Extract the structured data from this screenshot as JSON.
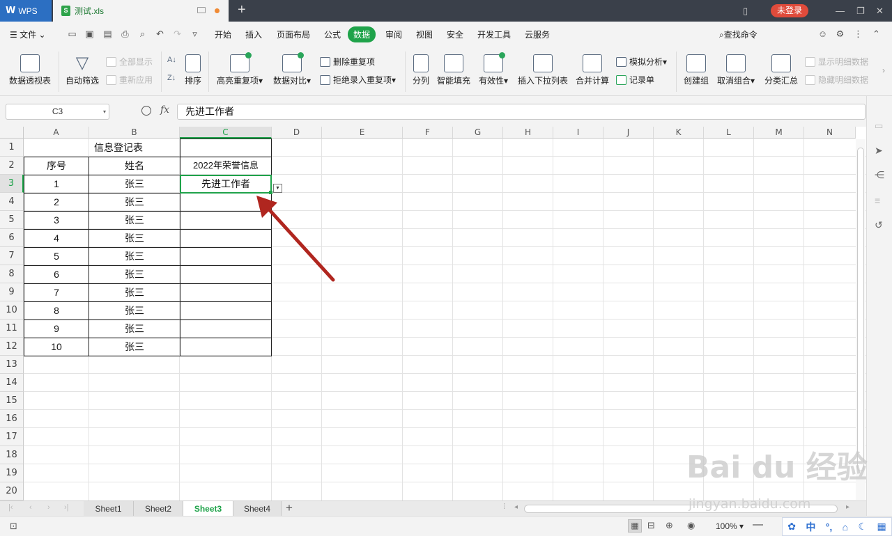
{
  "titlebar": {
    "app_label": "WPS",
    "doc_name": "测试.xls",
    "login_label": "未登录"
  },
  "menu": {
    "file_label": "文件",
    "tabs": [
      "开始",
      "插入",
      "页面布局",
      "公式",
      "数据",
      "审阅",
      "视图",
      "安全",
      "开发工具",
      "云服务"
    ],
    "active_tab": "数据",
    "search_label": "查找命令"
  },
  "ribbon": {
    "pivot": "数据透视表",
    "autofilter": "自动筛选",
    "show_all": "全部显示",
    "reapply": "重新应用",
    "sort": "排序",
    "highlight_dup": "高亮重复项",
    "compare": "数据对比",
    "delete_dup": "删除重复项",
    "reject_dup": "拒绝录入重复项",
    "split": "分列",
    "smart_fill": "智能填充",
    "validity": "有效性",
    "insert_dropdown": "插入下拉列表",
    "consolidate": "合并计算",
    "what_if": "模拟分析",
    "record": "记录单",
    "group": "创建组",
    "ungroup": "取消组合",
    "subtotal": "分类汇总",
    "show_detail": "显示明细数据",
    "hide_detail": "隐藏明细数据"
  },
  "formula_bar": {
    "name_box": "C3",
    "fx_label": "fx",
    "value": "先进工作者"
  },
  "grid": {
    "columns": [
      "A",
      "B",
      "C",
      "D",
      "E",
      "F",
      "G",
      "H",
      "I",
      "J",
      "K",
      "L",
      "M",
      "N"
    ],
    "rows": [
      "1",
      "2",
      "3",
      "4",
      "5",
      "6",
      "7",
      "8",
      "9",
      "10",
      "11",
      "12",
      "13",
      "14",
      "15",
      "16",
      "17",
      "18",
      "19",
      "20"
    ],
    "title": "信息登记表",
    "headers": [
      "序号",
      "姓名",
      "2022年荣誉信息"
    ],
    "data": [
      [
        "1",
        "张三",
        "先进工作者"
      ],
      [
        "2",
        "张三",
        ""
      ],
      [
        "3",
        "张三",
        ""
      ],
      [
        "4",
        "张三",
        ""
      ],
      [
        "5",
        "张三",
        ""
      ],
      [
        "6",
        "张三",
        ""
      ],
      [
        "7",
        "张三",
        ""
      ],
      [
        "8",
        "张三",
        ""
      ],
      [
        "9",
        "张三",
        ""
      ],
      [
        "10",
        "张三",
        ""
      ]
    ]
  },
  "sheets": [
    "Sheet1",
    "Sheet2",
    "Sheet3",
    "Sheet4"
  ],
  "active_sheet": "Sheet3",
  "status": {
    "zoom": "100%",
    "ime_label": "中"
  },
  "watermark": {
    "logo": "Bai du 经验",
    "url": "jingyan.baidu.com"
  },
  "colors": {
    "accent": "#1fa34a",
    "wps_blue": "#2c6fc2",
    "login_red": "#e04b3b",
    "arrow": "#b0261f"
  }
}
